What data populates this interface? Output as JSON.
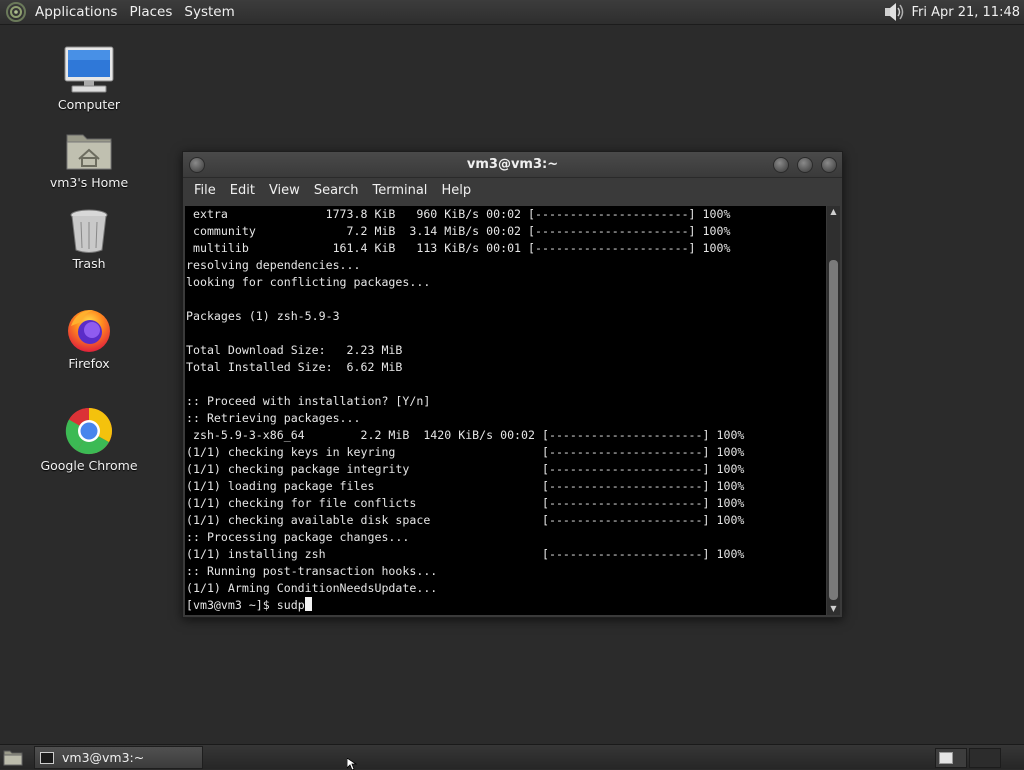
{
  "top_panel": {
    "menus": [
      "Applications",
      "Places",
      "System"
    ],
    "distro_icon": "distro-logo-icon",
    "volume_icon": "volume-icon",
    "clock": "Fri Apr 21, 11:48"
  },
  "desktop": {
    "icons": [
      {
        "label": "Computer",
        "icon": "computer-icon"
      },
      {
        "label": "vm3's Home",
        "icon": "home-folder-icon"
      },
      {
        "label": "Trash",
        "icon": "trash-icon"
      },
      {
        "label": "Firefox",
        "icon": "firefox-icon"
      },
      {
        "label": "Google Chrome",
        "icon": "chrome-icon"
      }
    ]
  },
  "terminal_window": {
    "title": "vm3@vm3:~",
    "menu": [
      "File",
      "Edit",
      "View",
      "Search",
      "Terminal",
      "Help"
    ],
    "lines": [
      " extra              1773.8 KiB   960 KiB/s 00:02 [----------------------] 100%",
      " community             7.2 MiB  3.14 MiB/s 00:02 [----------------------] 100%",
      " multilib            161.4 KiB   113 KiB/s 00:01 [----------------------] 100%",
      "resolving dependencies...",
      "looking for conflicting packages...",
      "",
      "Packages (1) zsh-5.9-3",
      "",
      "Total Download Size:   2.23 MiB",
      "Total Installed Size:  6.62 MiB",
      "",
      ":: Proceed with installation? [Y/n]",
      ":: Retrieving packages...",
      " zsh-5.9-3-x86_64        2.2 MiB  1420 KiB/s 00:02 [----------------------] 100%",
      "(1/1) checking keys in keyring                     [----------------------] 100%",
      "(1/1) checking package integrity                   [----------------------] 100%",
      "(1/1) loading package files                        [----------------------] 100%",
      "(1/1) checking for file conflicts                  [----------------------] 100%",
      "(1/1) checking available disk space                [----------------------] 100%",
      ":: Processing package changes...",
      "(1/1) installing zsh                               [----------------------] 100%",
      ":: Running post-transaction hooks...",
      "(1/1) Arming ConditionNeedsUpdate..."
    ],
    "prompt": "[vm3@vm3 ~]$ ",
    "input": "sudp"
  },
  "taskbar": {
    "tasks": [
      {
        "label": "vm3@vm3:~",
        "icon": "terminal-icon"
      }
    ],
    "show_desktop_icon": "show-desktop-icon",
    "workspaces": 2
  },
  "colors": {
    "desktop_bg": "#2b2b2b",
    "panel_bg": "#333333",
    "terminal_bg": "#000000",
    "terminal_fg": "#e6e6e6"
  }
}
